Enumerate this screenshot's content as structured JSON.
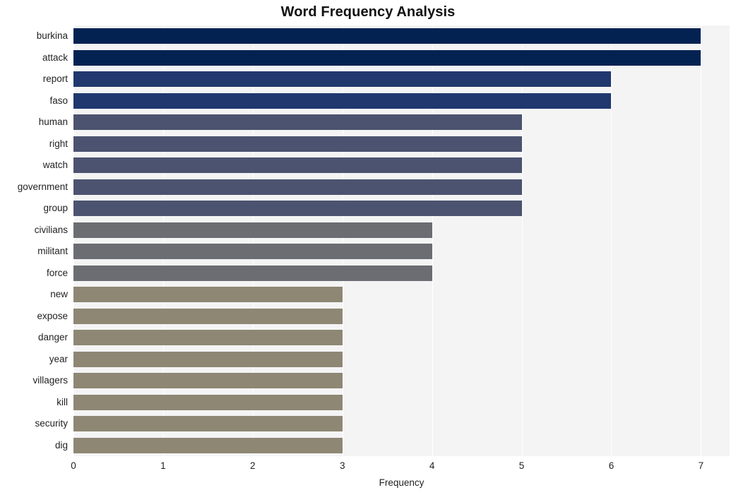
{
  "chart_data": {
    "type": "bar",
    "orientation": "horizontal",
    "title": "Word Frequency Analysis",
    "xlabel": "Frequency",
    "ylabel": "",
    "categories": [
      "burkina",
      "attack",
      "report",
      "faso",
      "human",
      "right",
      "watch",
      "government",
      "group",
      "civilians",
      "militant",
      "force",
      "new",
      "expose",
      "danger",
      "year",
      "villagers",
      "kill",
      "security",
      "dig"
    ],
    "values": [
      7,
      7,
      6,
      6,
      5,
      5,
      5,
      5,
      5,
      4,
      4,
      4,
      3,
      3,
      3,
      3,
      3,
      3,
      3,
      3
    ],
    "bar_colors": [
      "#032252",
      "#032252",
      "#20386e",
      "#20386e",
      "#4c5370",
      "#4c5370",
      "#4c5370",
      "#4c5370",
      "#4c5370",
      "#6b6d72",
      "#6b6d72",
      "#6b6d72",
      "#8e8774",
      "#8e8774",
      "#8e8774",
      "#8e8774",
      "#8e8774",
      "#8e8774",
      "#8e8774",
      "#8e8774"
    ],
    "xlim": [
      0,
      7.32
    ],
    "x_ticks": [
      0,
      1,
      2,
      3,
      4,
      5,
      6,
      7
    ],
    "x_tick_labels": [
      "0",
      "1",
      "2",
      "3",
      "4",
      "5",
      "6",
      "7"
    ],
    "grid": true,
    "grid_axis": "x",
    "grid_color": "#ffffff",
    "plot_background": "#f4f4f5",
    "figure_background": "#ffffff",
    "legend": null
  }
}
